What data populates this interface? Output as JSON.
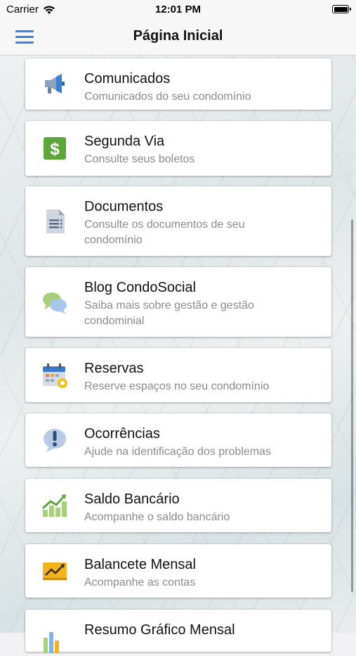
{
  "status_bar": {
    "carrier": "Carrier",
    "time": "12:01 PM"
  },
  "nav": {
    "title": "Página Inicial"
  },
  "items": [
    {
      "title": "Comunicados",
      "subtitle": "Comunicados do seu condomínio",
      "icon": "megaphone-icon"
    },
    {
      "title": "Segunda Via",
      "subtitle": "Consulte seus boletos",
      "icon": "dollar-bill-icon"
    },
    {
      "title": "Documentos",
      "subtitle": "Consulte os documentos de seu condomínio",
      "icon": "document-icon"
    },
    {
      "title": "Blog CondoSocial",
      "subtitle": "Saiba mais sobre gestão e gestão condominial",
      "icon": "chat-bubbles-icon"
    },
    {
      "title": "Reservas",
      "subtitle": "Reserve espaços no seu condomínio",
      "icon": "calendar-icon"
    },
    {
      "title": "Ocorrências",
      "subtitle": "Ajude na identificação dos problemas",
      "icon": "alert-bubble-icon"
    },
    {
      "title": "Saldo Bancário",
      "subtitle": "Acompanhe o saldo bancário",
      "icon": "growth-chart-icon"
    },
    {
      "title": "Balancete Mensal",
      "subtitle": "Acompanhe as contas",
      "icon": "trend-board-icon"
    },
    {
      "title": "Resumo Gráfico Mensal",
      "subtitle": "",
      "icon": "bar-chart-icon"
    }
  ]
}
